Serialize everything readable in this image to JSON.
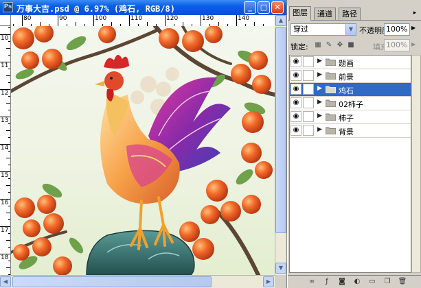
{
  "window": {
    "app_icon": "ps-icon",
    "title": "万事大吉.psd @ 6.97% (鸡石, RGB/8)",
    "min": "_",
    "max": "□",
    "close": "✕"
  },
  "rulers": {
    "h_labels": [
      "80",
      "90",
      "100",
      "110",
      "120",
      "130",
      "140"
    ],
    "v_labels": [
      "10",
      "11",
      "12",
      "13",
      "14",
      "15",
      "16",
      "17",
      "18"
    ]
  },
  "canvas": {
    "artwork": "rooster-on-rock-with-persimmons"
  },
  "panel": {
    "tabs": [
      {
        "label": "图层",
        "active": true
      },
      {
        "label": "通道",
        "active": false
      },
      {
        "label": "路径",
        "active": false
      }
    ],
    "menu_icon": "▸",
    "blend_mode": "穿过",
    "opacity_label": "不透明度:",
    "opacity_value": "100%",
    "lock_label": "锁定:",
    "fill_label": "填充:",
    "fill_value": "100%",
    "layers": [
      {
        "name": "题画",
        "visible": true,
        "selected": false
      },
      {
        "name": "前景",
        "visible": true,
        "selected": false
      },
      {
        "name": "鸡石",
        "visible": true,
        "selected": true
      },
      {
        "name": "02柿子",
        "visible": true,
        "selected": false
      },
      {
        "name": "柿子",
        "visible": true,
        "selected": false
      },
      {
        "name": "背景",
        "visible": true,
        "selected": false
      }
    ]
  },
  "colors": {
    "titlebar": "#0a5fe6",
    "selected_row": "#3169c6",
    "panel_bg": "#d4d0c8"
  }
}
